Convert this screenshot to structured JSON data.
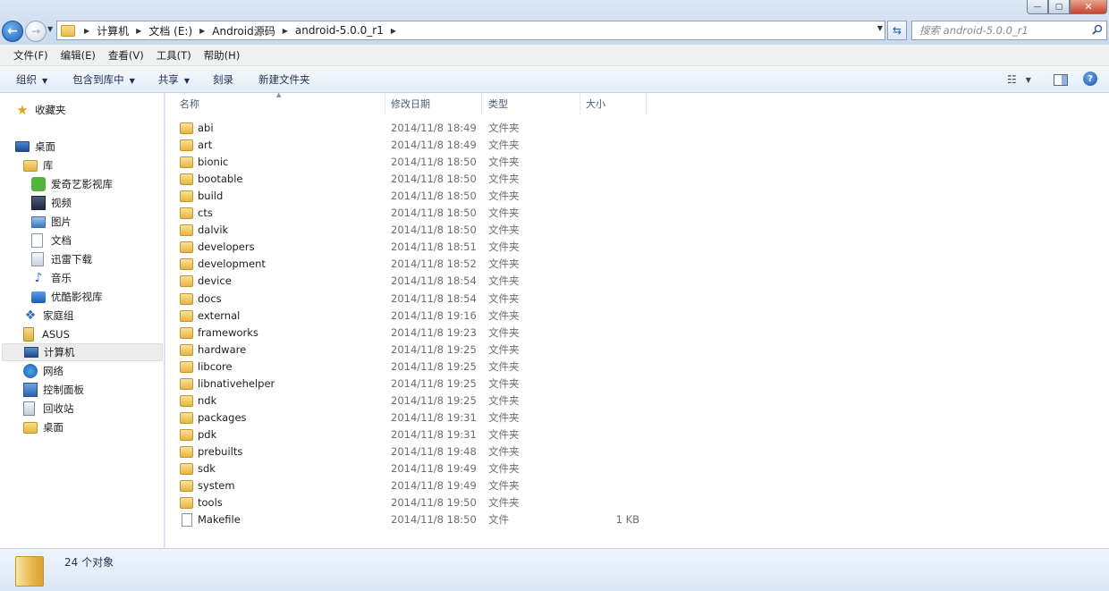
{
  "window": {
    "min_label": "—",
    "max_label": "▢",
    "close_label": "✕"
  },
  "address": {
    "crumbs": [
      "计算机",
      "文档 (E:)",
      "Android源码",
      "android-5.0.0_r1"
    ]
  },
  "search": {
    "placeholder": "搜索 android-5.0.0_r1"
  },
  "menu": [
    "文件(F)",
    "编辑(E)",
    "查看(V)",
    "工具(T)",
    "帮助(H)"
  ],
  "commands": {
    "organize": "组织",
    "include_library": "包含到库中",
    "share": "共享",
    "burn": "刻录",
    "new_folder": "新建文件夹"
  },
  "sidebar": {
    "favorites": "收藏夹",
    "desktop": "桌面",
    "library": "库",
    "library_items": [
      "爱奇艺影视库",
      "视频",
      "图片",
      "文档",
      "迅雷下载",
      "音乐",
      "优酷影视库"
    ],
    "homegroup": "家庭组",
    "asus": "ASUS",
    "computer": "计算机",
    "network": "网络",
    "control_panel": "控制面板",
    "recycle_bin": "回收站",
    "desktop2": "桌面"
  },
  "columns": {
    "name": "名称",
    "date": "修改日期",
    "type": "类型",
    "size": "大小"
  },
  "files": [
    {
      "name": "abi",
      "date": "2014/11/8 18:49",
      "type": "文件夹",
      "size": ""
    },
    {
      "name": "art",
      "date": "2014/11/8 18:49",
      "type": "文件夹",
      "size": ""
    },
    {
      "name": "bionic",
      "date": "2014/11/8 18:50",
      "type": "文件夹",
      "size": ""
    },
    {
      "name": "bootable",
      "date": "2014/11/8 18:50",
      "type": "文件夹",
      "size": ""
    },
    {
      "name": "build",
      "date": "2014/11/8 18:50",
      "type": "文件夹",
      "size": ""
    },
    {
      "name": "cts",
      "date": "2014/11/8 18:50",
      "type": "文件夹",
      "size": ""
    },
    {
      "name": "dalvik",
      "date": "2014/11/8 18:50",
      "type": "文件夹",
      "size": ""
    },
    {
      "name": "developers",
      "date": "2014/11/8 18:51",
      "type": "文件夹",
      "size": ""
    },
    {
      "name": "development",
      "date": "2014/11/8 18:52",
      "type": "文件夹",
      "size": ""
    },
    {
      "name": "device",
      "date": "2014/11/8 18:54",
      "type": "文件夹",
      "size": ""
    },
    {
      "name": "docs",
      "date": "2014/11/8 18:54",
      "type": "文件夹",
      "size": ""
    },
    {
      "name": "external",
      "date": "2014/11/8 19:16",
      "type": "文件夹",
      "size": ""
    },
    {
      "name": "frameworks",
      "date": "2014/11/8 19:23",
      "type": "文件夹",
      "size": ""
    },
    {
      "name": "hardware",
      "date": "2014/11/8 19:25",
      "type": "文件夹",
      "size": ""
    },
    {
      "name": "libcore",
      "date": "2014/11/8 19:25",
      "type": "文件夹",
      "size": ""
    },
    {
      "name": "libnativehelper",
      "date": "2014/11/8 19:25",
      "type": "文件夹",
      "size": ""
    },
    {
      "name": "ndk",
      "date": "2014/11/8 19:25",
      "type": "文件夹",
      "size": ""
    },
    {
      "name": "packages",
      "date": "2014/11/8 19:31",
      "type": "文件夹",
      "size": ""
    },
    {
      "name": "pdk",
      "date": "2014/11/8 19:31",
      "type": "文件夹",
      "size": ""
    },
    {
      "name": "prebuilts",
      "date": "2014/11/8 19:48",
      "type": "文件夹",
      "size": ""
    },
    {
      "name": "sdk",
      "date": "2014/11/8 19:49",
      "type": "文件夹",
      "size": ""
    },
    {
      "name": "system",
      "date": "2014/11/8 19:49",
      "type": "文件夹",
      "size": ""
    },
    {
      "name": "tools",
      "date": "2014/11/8 19:50",
      "type": "文件夹",
      "size": ""
    },
    {
      "name": "Makefile",
      "date": "2014/11/8 18:50",
      "type": "文件",
      "size": "1 KB"
    }
  ],
  "status": {
    "count": "24 个对象"
  }
}
